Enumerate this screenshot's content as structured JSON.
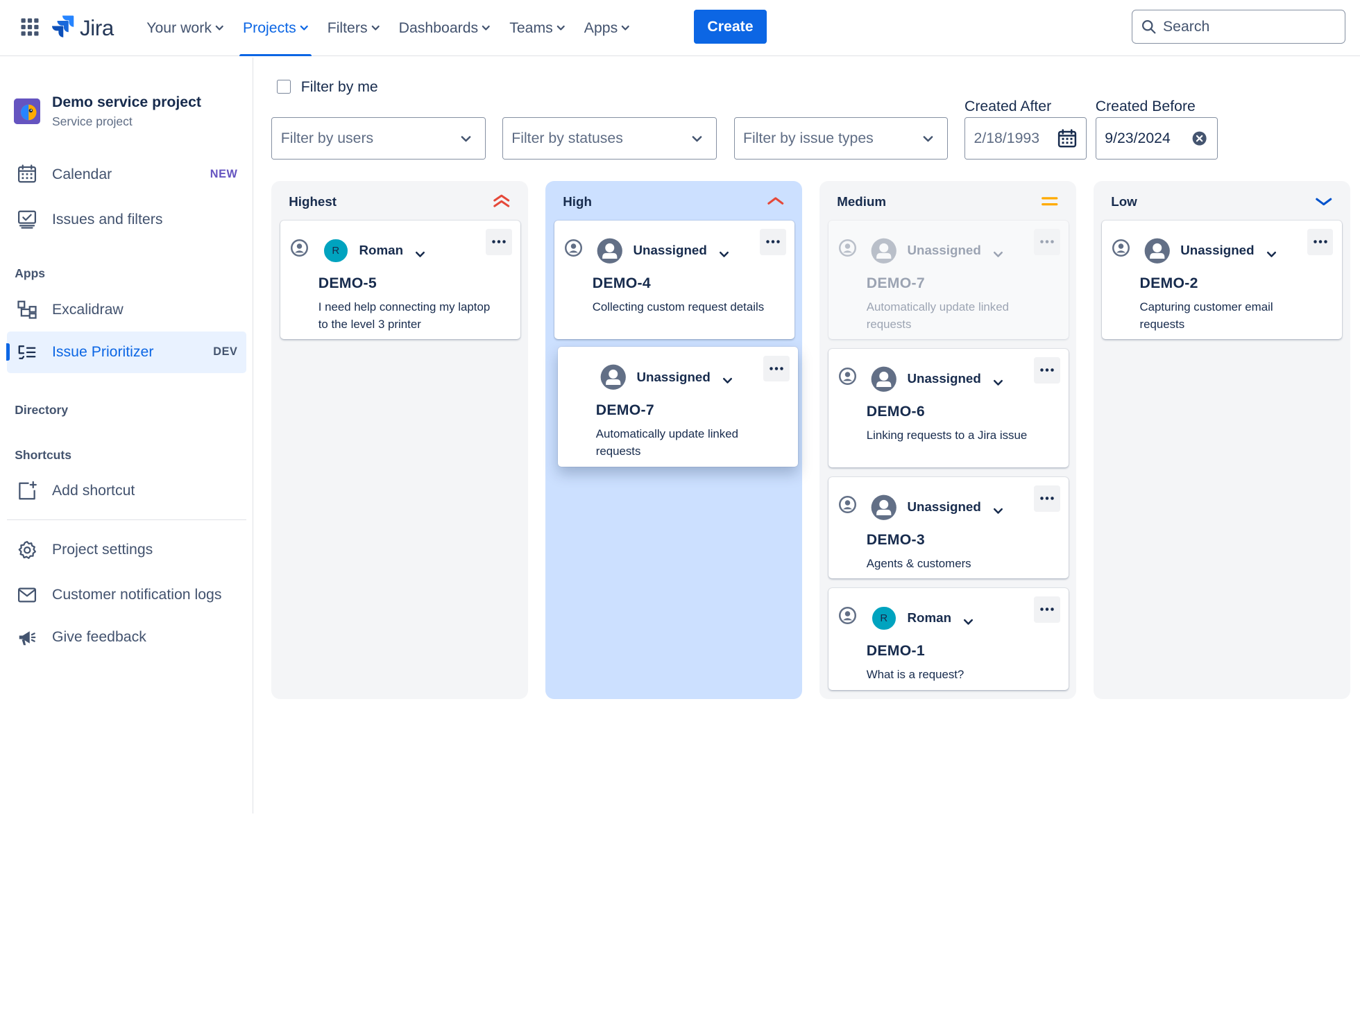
{
  "app": {
    "logo_text": "Jira",
    "nav": [
      {
        "label": "Your work"
      },
      {
        "label": "Projects"
      },
      {
        "label": "Filters"
      },
      {
        "label": "Dashboards"
      },
      {
        "label": "Teams"
      },
      {
        "label": "Apps"
      }
    ],
    "active_nav": "Projects",
    "create_label": "Create",
    "search_placeholder": "Search"
  },
  "sidebar": {
    "project_name": "Demo service project",
    "project_type": "Service project",
    "calendar_label": "Calendar",
    "calendar_badge": "NEW",
    "issues_label": "Issues and filters",
    "apps_heading": "Apps",
    "excalidraw_label": "Excalidraw",
    "prioritizer_label": "Issue Prioritizer",
    "prioritizer_badge": "DEV",
    "directory_heading": "Directory",
    "shortcuts_heading": "Shortcuts",
    "add_shortcut_label": "Add shortcut",
    "project_settings_label": "Project settings",
    "notification_logs_label": "Customer notification logs",
    "feedback_label": "Give feedback"
  },
  "filters": {
    "filter_by_me_label": "Filter by me",
    "filter_by_me_checked": false,
    "users_placeholder": "Filter by users",
    "statuses_placeholder": "Filter by statuses",
    "issue_types_placeholder": "Filter by issue types",
    "created_after_label": "Created After",
    "created_after_value": "2/18/1993",
    "created_before_label": "Created Before",
    "created_before_value": "9/23/2024"
  },
  "board": {
    "columns": [
      {
        "title": "Highest",
        "icon": "priority-highest-icon",
        "color": "#e5493a"
      },
      {
        "title": "High",
        "icon": "priority-high-icon",
        "color": "#e5493a"
      },
      {
        "title": "Medium",
        "icon": "priority-medium-icon",
        "color": "#ffab00"
      },
      {
        "title": "Low",
        "icon": "priority-low-icon",
        "color": "#0052cc"
      }
    ],
    "cards": {
      "highest_0": {
        "assignee": "Roman",
        "avatar_initial": "R",
        "key": "DEMO-5",
        "summary": "I need help connecting my laptop to the level 3 printer"
      },
      "high_0": {
        "assignee": "Unassigned",
        "key": "DEMO-4",
        "summary": "Collecting custom request details"
      },
      "high_drag": {
        "assignee": "Unassigned",
        "key": "DEMO-7",
        "summary": "Automatically update linked requests"
      },
      "medium_0": {
        "assignee": "Unassigned",
        "key": "DEMO-7",
        "summary": "Automatically update linked requests"
      },
      "medium_1": {
        "assignee": "Unassigned",
        "key": "DEMO-6",
        "summary": "Linking requests to a Jira issue"
      },
      "medium_2": {
        "assignee": "Unassigned",
        "key": "DEMO-3",
        "summary": "Agents & customers"
      },
      "medium_3": {
        "assignee": "Roman",
        "avatar_initial": "R",
        "key": "DEMO-1",
        "summary": "What is a request?"
      },
      "low_0": {
        "assignee": "Unassigned",
        "key": "DEMO-2",
        "summary": "Capturing customer email requests"
      }
    }
  },
  "colors": {
    "brand": "#0c66e4",
    "column_bg": "#f4f5f7",
    "drop_target_bg": "#cce0ff",
    "roman_avatar": "#00a3bf"
  }
}
